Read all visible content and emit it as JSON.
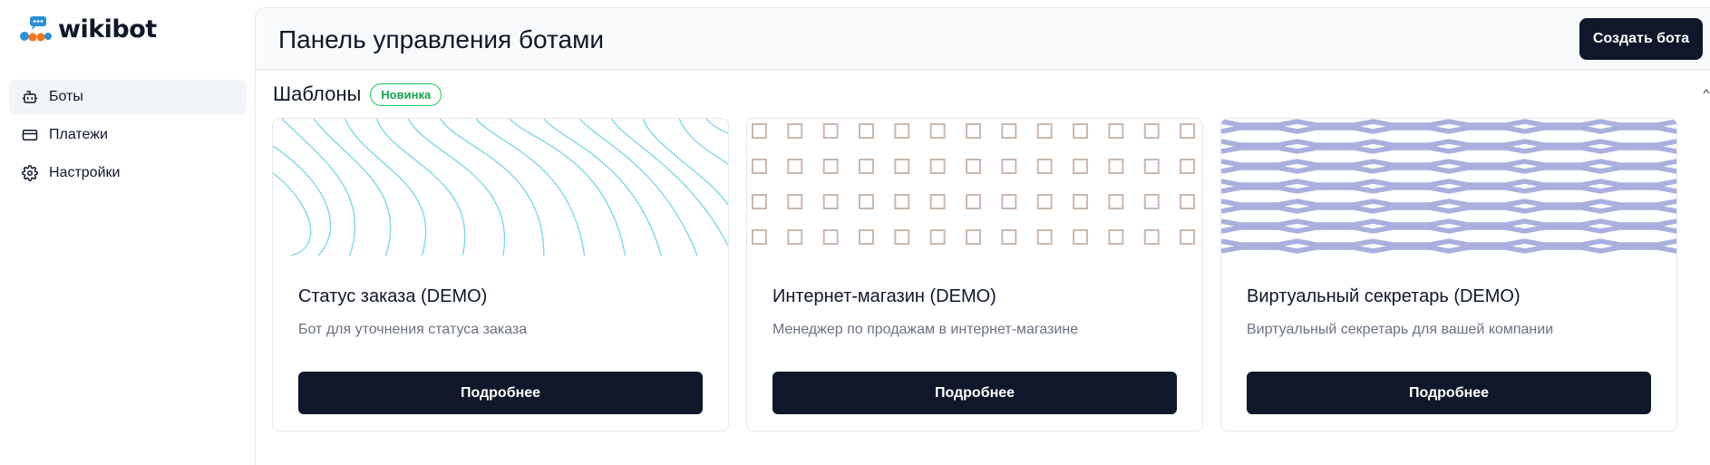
{
  "brand": {
    "name": "wikibot",
    "colors": {
      "blue": "#2b8fd6",
      "orange": "#f97316",
      "dark": "#0f172a"
    }
  },
  "sidebar": {
    "items": [
      {
        "label": "Боты",
        "icon": "bot-icon",
        "active": true
      },
      {
        "label": "Платежи",
        "icon": "credit-card-icon",
        "active": false
      },
      {
        "label": "Настройки",
        "icon": "gear-icon",
        "active": false
      }
    ]
  },
  "header": {
    "title": "Панель управления ботами",
    "create_label": "Создать бота"
  },
  "templates": {
    "title": "Шаблоны",
    "badge": "Новинка",
    "cards": [
      {
        "title": "Статус заказа (DEMO)",
        "desc": "Бот для уточнения статуса заказа",
        "button": "Подробнее",
        "pattern": "topographic-lines",
        "color": "#67d3e0"
      },
      {
        "title": "Интернет-магазин (DEMO)",
        "desc": "Менеджер по продажам в интернет-магазине",
        "button": "Подробнее",
        "pattern": "square-grid",
        "color": "#c9b8ad"
      },
      {
        "title": "Виртуальный секретарь (DEMO)",
        "desc": "Виртуальный секретарь для вашей компании",
        "button": "Подробнее",
        "pattern": "zigzag-stripes",
        "color": "#a9b0de"
      }
    ]
  }
}
